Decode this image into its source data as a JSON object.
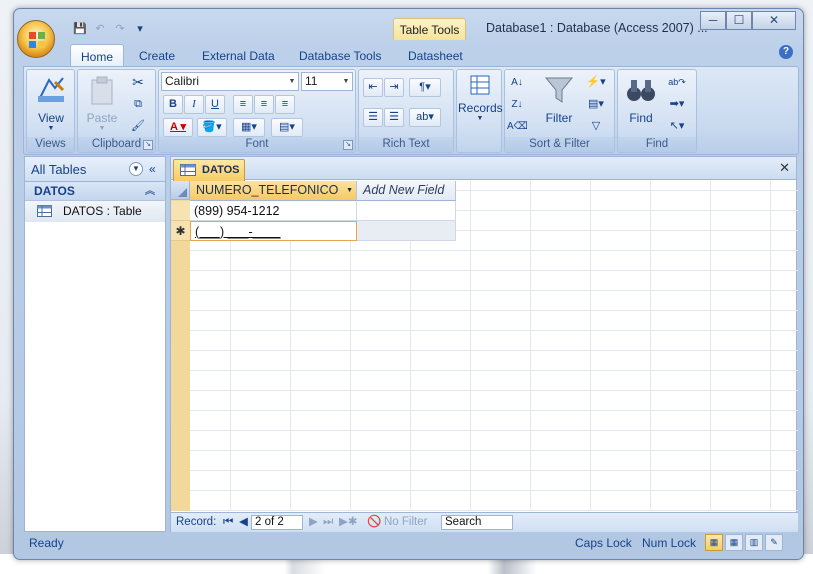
{
  "window": {
    "title": "Database1 : Database (Access 2007) ...",
    "contextual_tab": "Table Tools",
    "controls": {
      "minimize": "─",
      "maximize": "☐",
      "close": "✕"
    }
  },
  "qat": {
    "save": "💾",
    "undo": "↶",
    "redo": "↷",
    "customize": "▾"
  },
  "tabs": [
    "Home",
    "Create",
    "External Data",
    "Database Tools",
    "Datasheet"
  ],
  "ribbon": {
    "views": {
      "view_label": "View",
      "group": "Views"
    },
    "clipboard": {
      "paste_label": "Paste",
      "group": "Clipboard"
    },
    "font": {
      "font_name": "Calibri",
      "font_size": "11",
      "bold": "B",
      "italic": "I",
      "underline": "U",
      "group": "Font"
    },
    "rich_text": {
      "group": "Rich Text"
    },
    "records": {
      "label": "Records"
    },
    "sort_filter": {
      "filter_label": "Filter",
      "group": "Sort & Filter"
    },
    "find": {
      "find_label": "Find",
      "group": "Find"
    }
  },
  "nav": {
    "header": "All Tables",
    "group": "DATOS",
    "items": [
      {
        "label": "DATOS : Table"
      }
    ]
  },
  "document": {
    "tab": "DATOS",
    "columns": [
      "NUMERO_TELEFONICO",
      "Add New Field"
    ],
    "rows": [
      [
        "(899) 954-1212",
        ""
      ]
    ],
    "new_row_mask": "(___) ___-____",
    "new_row_marker": "✱"
  },
  "record_nav": {
    "label": "Record:",
    "position": "2 of 2",
    "filter": "No Filter",
    "search": "Search"
  },
  "status": {
    "left": "Ready",
    "caps": "Caps Lock",
    "num": "Num Lock"
  }
}
